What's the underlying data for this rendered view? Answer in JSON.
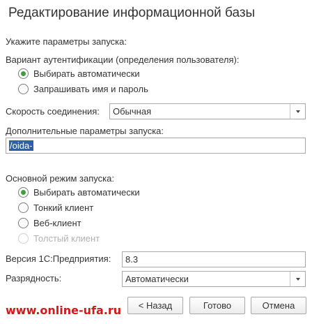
{
  "dialog": {
    "title": "Редактирование информационной базы",
    "intro": "Укажите параметры запуска:"
  },
  "auth": {
    "label": "Вариант аутентификации (определения пользователя):",
    "options": [
      {
        "label": "Выбирать автоматически",
        "checked": true
      },
      {
        "label": "Запрашивать имя и пароль",
        "checked": false
      }
    ]
  },
  "speed": {
    "label": "Скорость соединения:",
    "value": "Обычная"
  },
  "extra": {
    "label": "Дополнительные параметры запуска:",
    "value": "/oida-"
  },
  "mode": {
    "label": "Основной режим запуска:",
    "options": [
      {
        "label": "Выбирать автоматически",
        "checked": true,
        "disabled": false
      },
      {
        "label": "Тонкий клиент",
        "checked": false,
        "disabled": false
      },
      {
        "label": "Веб-клиент",
        "checked": false,
        "disabled": false
      },
      {
        "label": "Толстый клиент",
        "checked": false,
        "disabled": true
      }
    ]
  },
  "version": {
    "label": "Версия 1С:Предприятия:",
    "value": "8.3"
  },
  "bitness": {
    "label": "Разрядность:",
    "value": "Автоматически"
  },
  "buttons": {
    "back": "< Назад",
    "done": "Готово",
    "cancel": "Отмена"
  },
  "watermark": "www.online-ufa.ru",
  "colors": {
    "radio_checked": "#3f9f3f",
    "selection": "#2f5fa8",
    "watermark": "#d11a1a"
  }
}
